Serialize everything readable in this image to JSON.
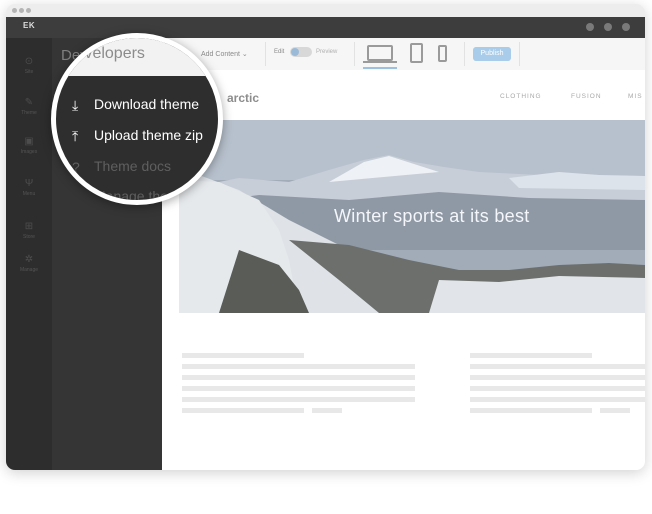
{
  "app": {
    "logo": "EK"
  },
  "sidebar": {
    "items": [
      {
        "label": "Site",
        "icon": "site-icon",
        "glyph": "⊙"
      },
      {
        "label": "Theme",
        "icon": "brush-icon",
        "glyph": "✎"
      },
      {
        "label": "Images",
        "icon": "image-icon",
        "glyph": "▣"
      },
      {
        "label": "Menu",
        "icon": "menu-fork-icon",
        "glyph": "Ψ"
      },
      {
        "label": "Store",
        "icon": "cart-icon",
        "glyph": "⊞"
      },
      {
        "label": "Manage",
        "icon": "gear-icon",
        "glyph": "✲"
      }
    ]
  },
  "panel": {
    "title": "Developers"
  },
  "toolbar": {
    "add_content": "Add Content",
    "edit": "Edit",
    "preview": "Preview",
    "publish": "Publish"
  },
  "site": {
    "logo": "arctic",
    "nav": [
      "CLOTHING",
      "FUSION",
      "MIS"
    ],
    "hero_text": "Winter sports at its best"
  },
  "menu": {
    "items": [
      {
        "label": "Download theme",
        "icon": "download-icon",
        "glyph": "⤓",
        "state": "active"
      },
      {
        "label": "Upload theme zip",
        "icon": "upload-icon",
        "glyph": "⤒",
        "state": "active"
      },
      {
        "label": "Theme docs",
        "icon": "help-icon",
        "glyph": "?",
        "state": "dimmed"
      },
      {
        "label": "Manage themes",
        "icon": "",
        "glyph": "",
        "state": "dimmed"
      }
    ]
  },
  "colors": {
    "accent": "#a8cce9",
    "sidebar": "#333333",
    "panel": "#3b3b3b",
    "topbar": "#3d3d3d"
  }
}
